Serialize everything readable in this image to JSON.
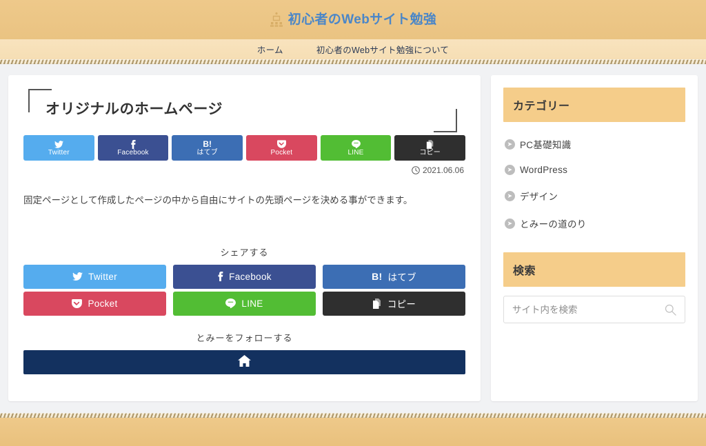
{
  "header": {
    "site_title": "初心者のWebサイト勉強",
    "logo_icon": "presentation-person-icon",
    "title_color": "#4a86c8",
    "background_color": "#eec98a"
  },
  "nav": {
    "items": [
      {
        "label": "ホーム"
      },
      {
        "label": "初心者のWebサイト勉強について"
      }
    ]
  },
  "main": {
    "entry_title": "オリジナルのホームページ",
    "post_date": "2021.06.06",
    "date_icon": "clock-icon",
    "post_text": "固定ページとして作成したページの中から自由にサイトの先頭ページを決める事ができます。",
    "share_top": [
      {
        "label": "Twitter",
        "icon": "twitter-bird-icon",
        "color": "#55acee"
      },
      {
        "label": "Facebook",
        "icon": "facebook-f-icon",
        "color": "#3b5092"
      },
      {
        "label": "はてブ",
        "icon": "hatena-b-icon",
        "badge": "B!",
        "color": "#3c6eb4"
      },
      {
        "label": "Pocket",
        "icon": "pocket-icon",
        "color": "#d9485f"
      },
      {
        "label": "LINE",
        "icon": "line-icon",
        "color": "#52bd34"
      },
      {
        "label": "コピー",
        "icon": "copy-icon",
        "color": "#2f2f2f"
      }
    ],
    "share_section_label": "シェアする",
    "share_bottom": [
      {
        "label": "Twitter",
        "icon": "twitter-bird-icon",
        "color": "#55acee"
      },
      {
        "label": "Facebook",
        "icon": "facebook-f-icon",
        "color": "#3b5092"
      },
      {
        "label": "はてブ",
        "icon": "hatena-b-icon",
        "badge": "B!",
        "color": "#3c6eb4"
      },
      {
        "label": "Pocket",
        "icon": "pocket-icon",
        "color": "#d9485f"
      },
      {
        "label": "LINE",
        "icon": "line-icon",
        "color": "#52bd34"
      },
      {
        "label": "コピー",
        "icon": "copy-icon",
        "color": "#2f2f2f"
      }
    ],
    "follow_section_label": "とみーをフォローする",
    "follow_button": {
      "icon": "home-icon",
      "color": "#13315f"
    }
  },
  "sidebar": {
    "categories_widget": {
      "title": "カテゴリー",
      "items": [
        {
          "label": "PC基礎知識"
        },
        {
          "label": "WordPress"
        },
        {
          "label": "デザイン"
        },
        {
          "label": "とみーの道のり"
        }
      ]
    },
    "search_widget": {
      "title": "検索",
      "placeholder": "サイト内を検索",
      "value": "",
      "icon": "search-icon"
    },
    "accent_color": "#f5cd8a"
  }
}
